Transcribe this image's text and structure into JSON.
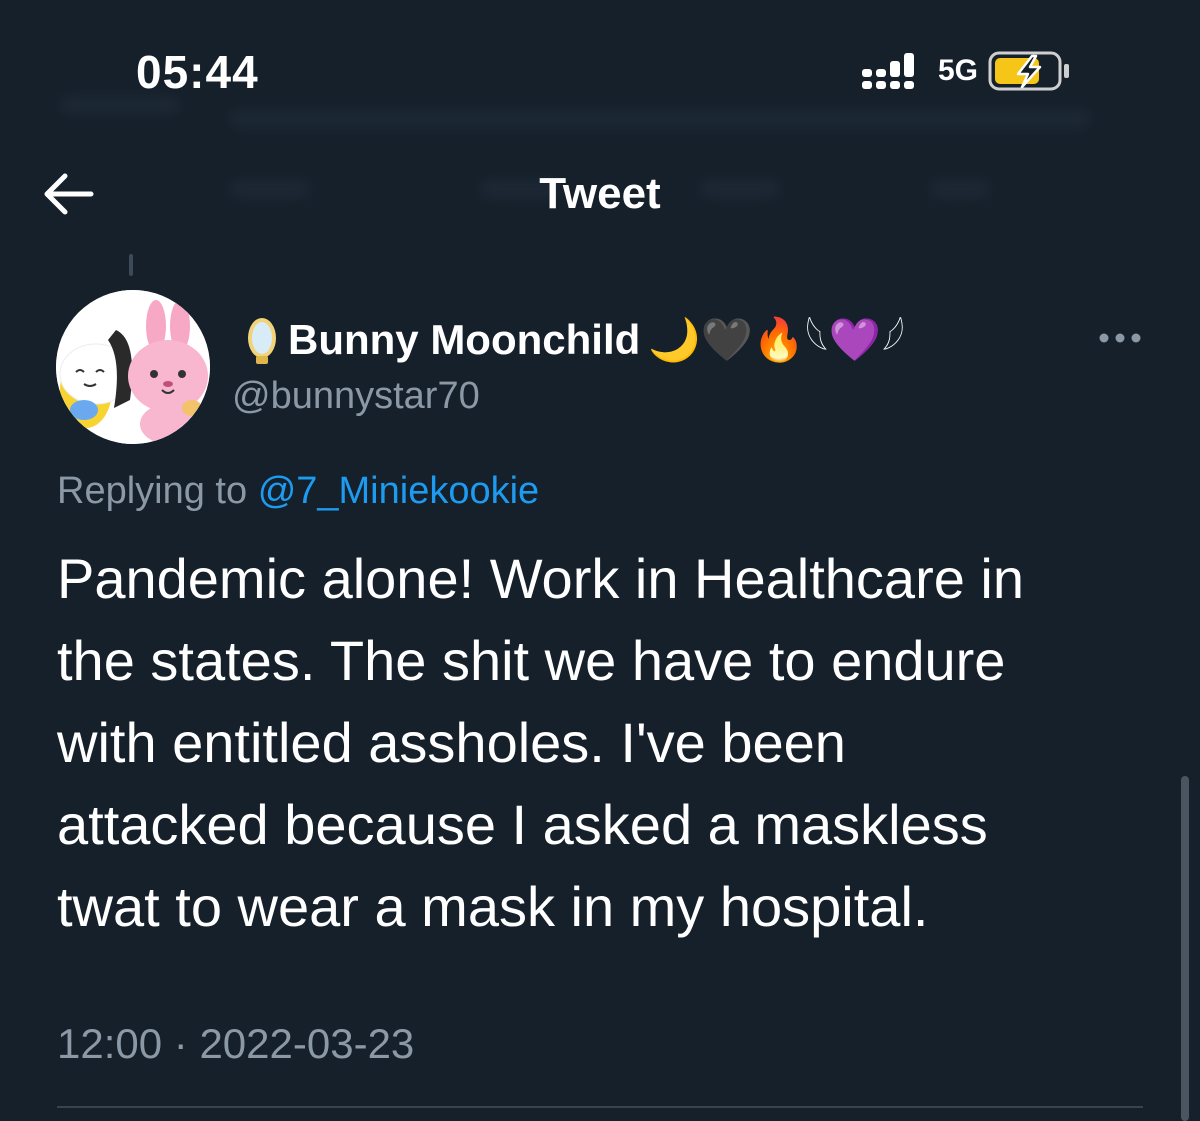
{
  "status_bar": {
    "time": "05:44",
    "network": "5G",
    "signal_icon": "signal-bars-icon",
    "battery_icon": "battery-charging-icon",
    "battery_color": "#f5c518"
  },
  "header": {
    "title": "Tweet",
    "back_icon": "arrow-left-icon"
  },
  "tweet": {
    "author": {
      "display_name": "Bunny Moonchild",
      "name_emojis": "🌙🖤🔥𓆩💜𓆪",
      "handle": "@bunnystar70",
      "avatar_icon": "bt21-chimmy-cooky-avatar",
      "prefix_icon": "mirror-icon"
    },
    "replying_prefix": "Replying to",
    "replying_to": "@7_Miniekookie",
    "text_lines": [
      "Pandemic alone! Work in Healthcare in",
      "the states. The shit we have to endure",
      "with entitled assholes. I've been",
      "attacked because I asked a maskless",
      "twat to wear a mask in my hospital."
    ],
    "time": "12:00",
    "separator": "·",
    "date": "2022-03-23",
    "more_icon": "more-horizontal-icon"
  },
  "colors": {
    "background": "#15202b",
    "text": "#ffffff",
    "secondary_text": "#8b98a5",
    "link": "#1d9bf0"
  }
}
